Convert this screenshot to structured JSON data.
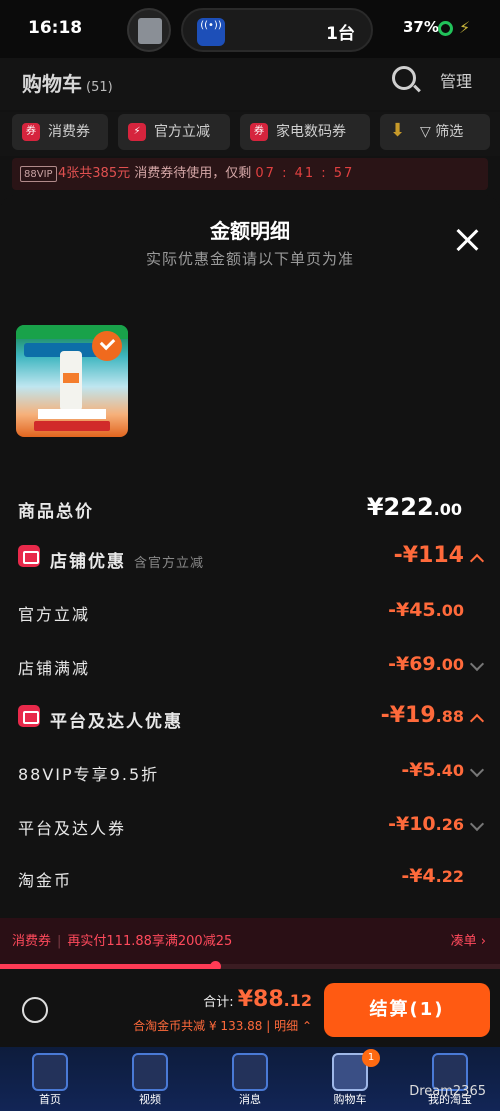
{
  "status": {
    "time": "16:18",
    "island_count": "1台",
    "battery": "37%"
  },
  "header": {
    "title": "购物车",
    "count": "(51)",
    "manage": "管理"
  },
  "filters": [
    {
      "label": "消费券"
    },
    {
      "label": "官方立减"
    },
    {
      "label": "家电数码券"
    },
    {
      "label": "筛选"
    }
  ],
  "vip_bar": {
    "badge": "88VIP",
    "highlight": "4张共385元",
    "text": "消费券待使用，仅剩",
    "timer": "07 : 41 : 57"
  },
  "sheet": {
    "title": "金额明细",
    "subtitle": "实际优惠金额请以下单页为准",
    "rows": [
      {
        "label": "商品总价",
        "amount": "¥222",
        "decimal": ".00"
      },
      {
        "label": "店铺优惠",
        "note": "含官方立减",
        "amount": "-¥114",
        "decimal": ""
      },
      {
        "label": "官方立减",
        "amount": "-¥45",
        "decimal": ".00"
      },
      {
        "label": "店铺满减",
        "amount": "-¥69",
        "decimal": ".00"
      },
      {
        "label": "平台及达人优惠",
        "amount": "-¥19",
        "decimal": ".88"
      },
      {
        "label": "88VIP专享9.5折",
        "amount": "-¥5",
        "decimal": ".40"
      },
      {
        "label": "平台及达人券",
        "amount": "-¥10",
        "decimal": ".26"
      },
      {
        "label": "淘金币",
        "amount": "-¥4",
        "decimal": ".22"
      }
    ]
  },
  "voucher_bar": {
    "tag": "消费券",
    "text": "再实付111.88享满200减25",
    "action": "凑单",
    "progress": 0.43
  },
  "checkout": {
    "total_label": "合计:",
    "total": "¥88",
    "total_decimal": ".12",
    "saving": "合淘金币共减 ¥ 133.88 | 明细",
    "button": "结算(1)"
  },
  "tabs": [
    {
      "label": "首页"
    },
    {
      "label": "视频"
    },
    {
      "label": "消息"
    },
    {
      "label": "购物车",
      "badge": "1"
    },
    {
      "label": "我的淘宝"
    }
  ],
  "watermark": "Dream2365"
}
